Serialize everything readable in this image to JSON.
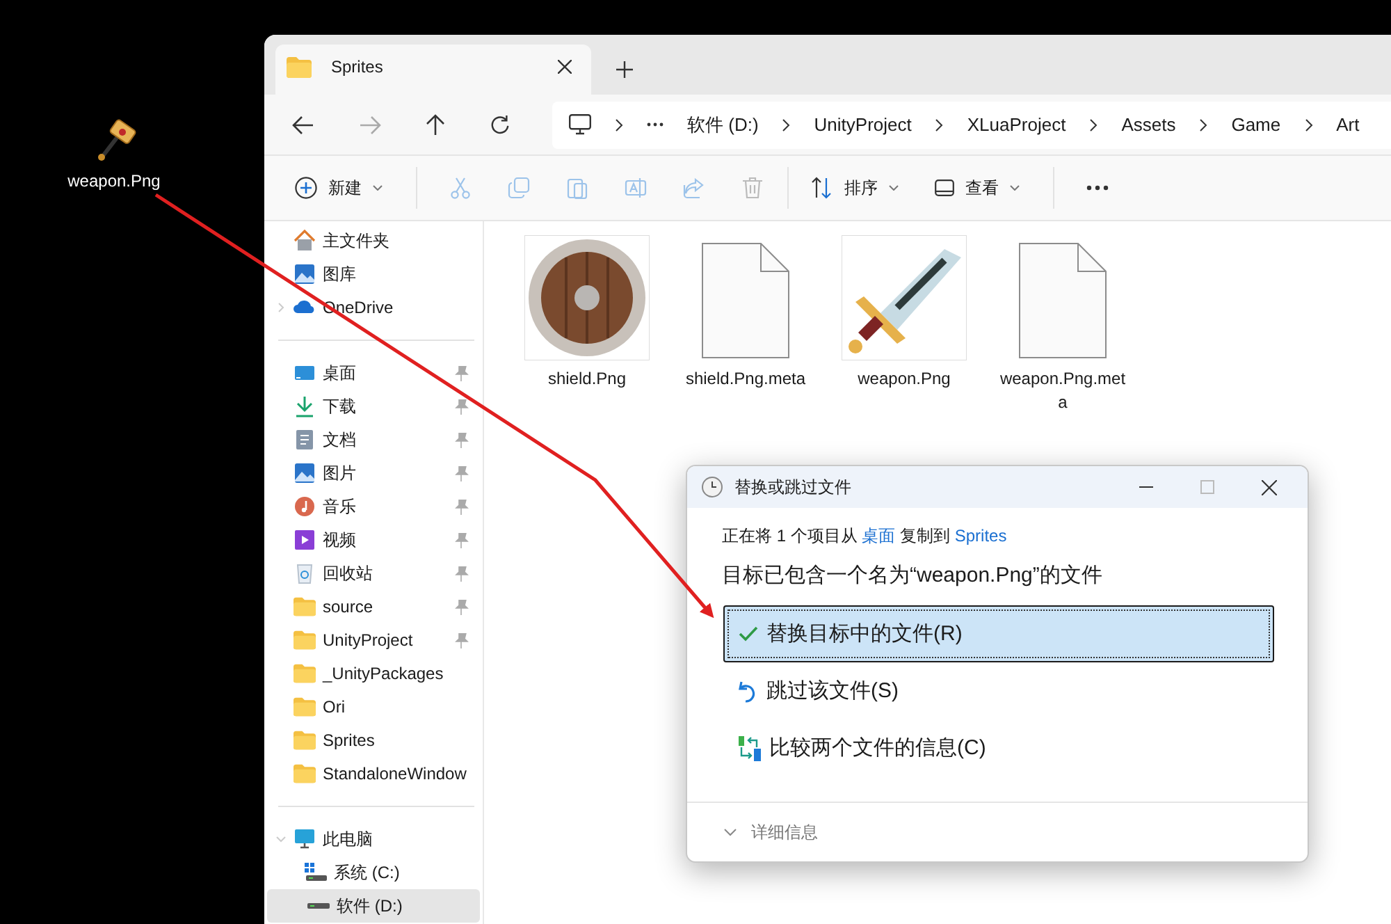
{
  "desktop_icon": {
    "label": "weapon.Png"
  },
  "explorer": {
    "tab": {
      "title": "Sprites"
    },
    "breadcrumb": [
      "软件 (D:)",
      "UnityProject",
      "XLuaProject",
      "Assets",
      "Game",
      "Art"
    ],
    "commands": {
      "new": "新建",
      "sort": "排序",
      "view": "查看"
    },
    "sidebar": {
      "sections": [
        [
          {
            "label": "主文件夹",
            "kind": "home",
            "pinned": false
          },
          {
            "label": "图库",
            "kind": "gallery",
            "pinned": false
          },
          {
            "label": "OneDrive",
            "kind": "cloud",
            "pinned": false,
            "expanded": false
          }
        ],
        [
          {
            "label": "桌面",
            "kind": "desktop",
            "pinned": true
          },
          {
            "label": "下载",
            "kind": "download",
            "pinned": true
          },
          {
            "label": "文档",
            "kind": "document",
            "pinned": true
          },
          {
            "label": "图片",
            "kind": "gallery",
            "pinned": true
          },
          {
            "label": "音乐",
            "kind": "music",
            "pinned": true
          },
          {
            "label": "视频",
            "kind": "video",
            "pinned": true
          },
          {
            "label": "回收站",
            "kind": "recycle",
            "pinned": true
          },
          {
            "label": "source",
            "kind": "folder",
            "pinned": true
          },
          {
            "label": "UnityProject",
            "kind": "folder",
            "pinned": true
          },
          {
            "label": "_UnityPackages",
            "kind": "folder",
            "pinned": false
          },
          {
            "label": "Ori",
            "kind": "folder",
            "pinned": false
          },
          {
            "label": "Sprites",
            "kind": "folder",
            "pinned": false
          },
          {
            "label": "StandaloneWindow",
            "kind": "folder",
            "pinned": false
          }
        ],
        [
          {
            "label": "此电脑",
            "kind": "pc",
            "pinned": false,
            "expanded": true,
            "children": [
              {
                "label": "系统 (C:)",
                "kind": "drive-win",
                "selected": false
              },
              {
                "label": "软件 (D:)",
                "kind": "drive",
                "selected": true
              }
            ]
          }
        ]
      ]
    },
    "files": [
      {
        "name": "shield.Png",
        "kind": "shield"
      },
      {
        "name": "shield.Png.meta",
        "kind": "blank"
      },
      {
        "name": "weapon.Png",
        "kind": "sword"
      },
      {
        "name": "weapon.Png.meta",
        "kind": "blank"
      }
    ]
  },
  "dialog": {
    "title": "替换或跳过文件",
    "message": {
      "before": "正在将 1 个项目从",
      "source": "桌面",
      "middle": "复制到",
      "destination": "Sprites"
    },
    "heading": "目标已包含一个名为“weapon.Png”的文件",
    "options": [
      {
        "label": "替换目标中的文件(R)",
        "kind": "replace",
        "selected": true
      },
      {
        "label": "跳过该文件(S)",
        "kind": "skip",
        "selected": false
      },
      {
        "label": "比较两个文件的信息(C)",
        "kind": "compare",
        "selected": false
      }
    ],
    "details": {
      "label": "详细信息",
      "expanded": false
    }
  }
}
